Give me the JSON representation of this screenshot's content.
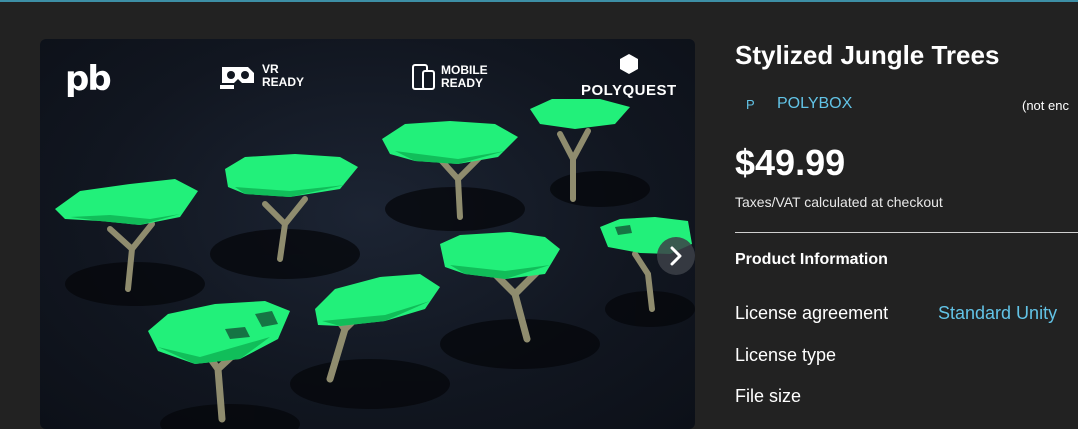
{
  "gallery": {
    "badges": {
      "logo": "pb",
      "vr_line1": "VR",
      "vr_line2": "READY",
      "mobile_line1": "MOBILE",
      "mobile_line2": "READY",
      "polyquest": "POLYQUEST"
    },
    "next_icon": "chevron-right-icon"
  },
  "product": {
    "title": "Stylized Jungle Trees",
    "publisher_initial": "P",
    "publisher_name": "POLYBOX",
    "publisher_note": "(not enc",
    "price": "$49.99",
    "taxes_note": "Taxes/VAT calculated at checkout"
  },
  "info": {
    "heading": "Product Information",
    "rows": [
      {
        "label": "License agreement",
        "value": "Standard Unity"
      },
      {
        "label": "License type",
        "value": ""
      },
      {
        "label": "File size",
        "value": ""
      }
    ]
  },
  "colors": {
    "background": "#222222",
    "accent_link": "#62c3e6",
    "canopy": "#22f07a"
  }
}
